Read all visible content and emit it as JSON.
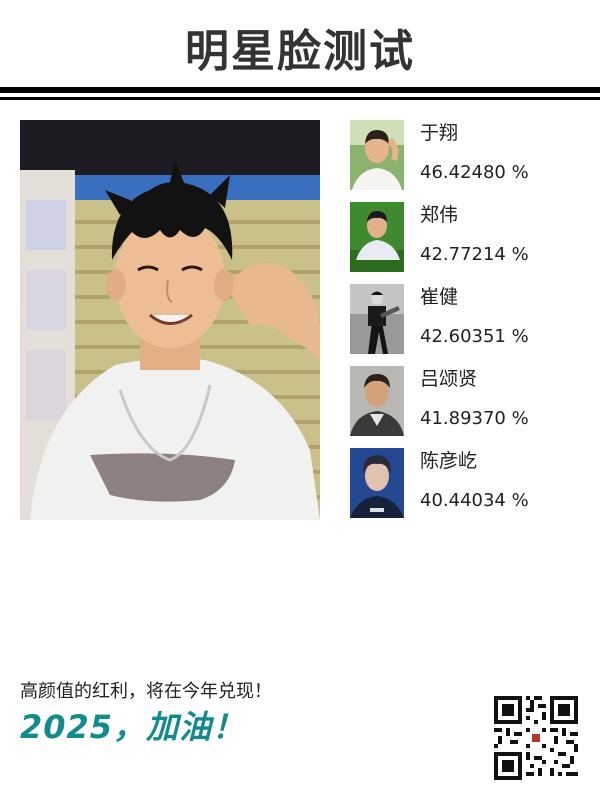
{
  "header": {
    "title": "明星脸测试"
  },
  "results": [
    {
      "name": "于翔",
      "score": "46.42480 %"
    },
    {
      "name": "郑伟",
      "score": "42.77214 %"
    },
    {
      "name": "崔健",
      "score": "42.60351 %"
    },
    {
      "name": "吕颂贤",
      "score": "41.89370 %"
    },
    {
      "name": "陈彦屹",
      "score": "40.44034 %"
    }
  ],
  "footer": {
    "tagline": "高颜值的红利，将在今年兑现！",
    "slogan": "2025，加油！"
  },
  "colors": {
    "slogan": "#138b8d",
    "rule": "#000000"
  }
}
